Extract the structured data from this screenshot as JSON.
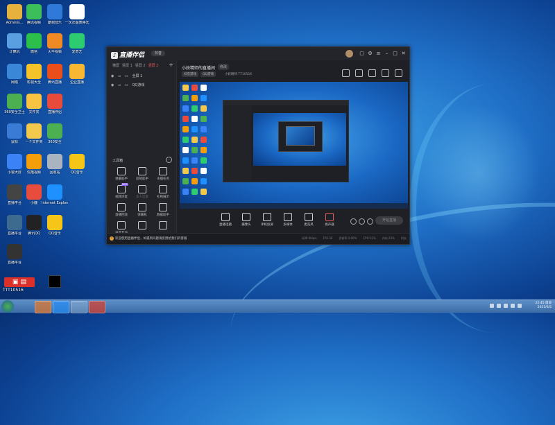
{
  "desktop": {
    "icons": [
      {
        "label": "Adminis...",
        "name": "folder-icon"
      },
      {
        "label": "腾讯视频",
        "name": "video-icon"
      },
      {
        "label": "酷狗音乐",
        "name": "music-icon"
      },
      {
        "label": "一次次图表格式",
        "name": "document-icon"
      },
      {
        "label": "计算机",
        "name": "computer-icon"
      },
      {
        "label": "微信",
        "name": "wechat-icon"
      },
      {
        "label": "火牛视频",
        "name": "app-icon"
      },
      {
        "label": "爱奇艺",
        "name": "iqiyi-icon"
      },
      {
        "label": "网络",
        "name": "network-icon"
      },
      {
        "label": "影视大全",
        "name": "app-icon"
      },
      {
        "label": "腾讯直播",
        "name": "app-icon"
      },
      {
        "label": "企业直播",
        "name": "app-icon"
      },
      {
        "label": "360安全卫士",
        "name": "security-icon"
      },
      {
        "label": "文件夹",
        "name": "folder-icon"
      },
      {
        "label": "直播伴侣",
        "name": "app-icon"
      },
      {
        "label": "鼠标",
        "name": "app-icon"
      },
      {
        "label": "一个文件夹",
        "name": "folder-icon"
      },
      {
        "label": "360安全",
        "name": "security-icon"
      },
      {
        "label": "小窗大屏",
        "name": "app-icon"
      },
      {
        "label": "优酷视频",
        "name": "app-icon"
      },
      {
        "label": "回收站",
        "name": "recycle-bin-icon"
      },
      {
        "label": "QQ音乐",
        "name": "qq-music-icon"
      },
      {
        "label": "直播平台",
        "name": "app-icon"
      },
      {
        "label": "小鹿",
        "name": "app-icon"
      },
      {
        "label": "Internet Explorer",
        "name": "ie-icon"
      },
      {
        "label": "直播平台",
        "name": "app-icon"
      },
      {
        "label": "腾讯QQ",
        "name": "qq-icon"
      },
      {
        "label": "QQ音乐",
        "name": "qq-music-icon"
      },
      {
        "label": "直播平台",
        "name": "app-icon"
      }
    ],
    "watermark_text": "TTT10516"
  },
  "app": {
    "logo_text": "直播伴侣",
    "version_badge": "抖音",
    "scene_tabs": [
      "横屏",
      "竖屏 1",
      "竖屏 2",
      "竖屏 2"
    ],
    "sources": [
      "全屏 1",
      "QQ游戏"
    ],
    "room_title": "小妖精师的直播间",
    "room_tag": "修改",
    "chips": [
      "抖音游戏",
      "QQ游戏"
    ],
    "room_id_line": "小妖精师  TT10516",
    "tools_title": "工具箱",
    "tools": [
      {
        "label": "弹幕助手",
        "badge": ""
      },
      {
        "label": "房管助手",
        "badge": ""
      },
      {
        "label": "主播任务",
        "badge": ""
      },
      {
        "label": "视频连麦",
        "badge": "NEW"
      },
      {
        "label": "多人连麦",
        "badge": ""
      },
      {
        "label": "礼物展示",
        "badge": ""
      },
      {
        "label": "直播回放",
        "badge": ""
      },
      {
        "label": "弹幕机",
        "badge": ""
      },
      {
        "label": "数据助手",
        "badge": ""
      },
      {
        "label": "语音互动",
        "badge": ""
      },
      {
        "label": "",
        "badge": ""
      },
      {
        "label": "",
        "badge": ""
      }
    ],
    "toolbar": [
      {
        "label": "直播话题",
        "name": "topic-button"
      },
      {
        "label": "摄像头",
        "name": "camera-button"
      },
      {
        "label": "手机投屏",
        "name": "phone-cast-button"
      },
      {
        "label": "多媒体",
        "name": "media-button"
      },
      {
        "label": "麦克风",
        "name": "microphone-button"
      },
      {
        "label": "扬声器",
        "name": "speaker-button"
      }
    ],
    "go_live": "开始直播",
    "status_text": "欢迎使用直播伴侣，如遇到问题请反馈给我们的客服",
    "stats": [
      "码率:0kbps",
      "FPS:30",
      "丢帧率:0.00%",
      "CPU:12%",
      "内存:23%",
      "时长"
    ]
  },
  "taskbar": {
    "time": "22:45 周日",
    "date": "2021/6/5"
  }
}
